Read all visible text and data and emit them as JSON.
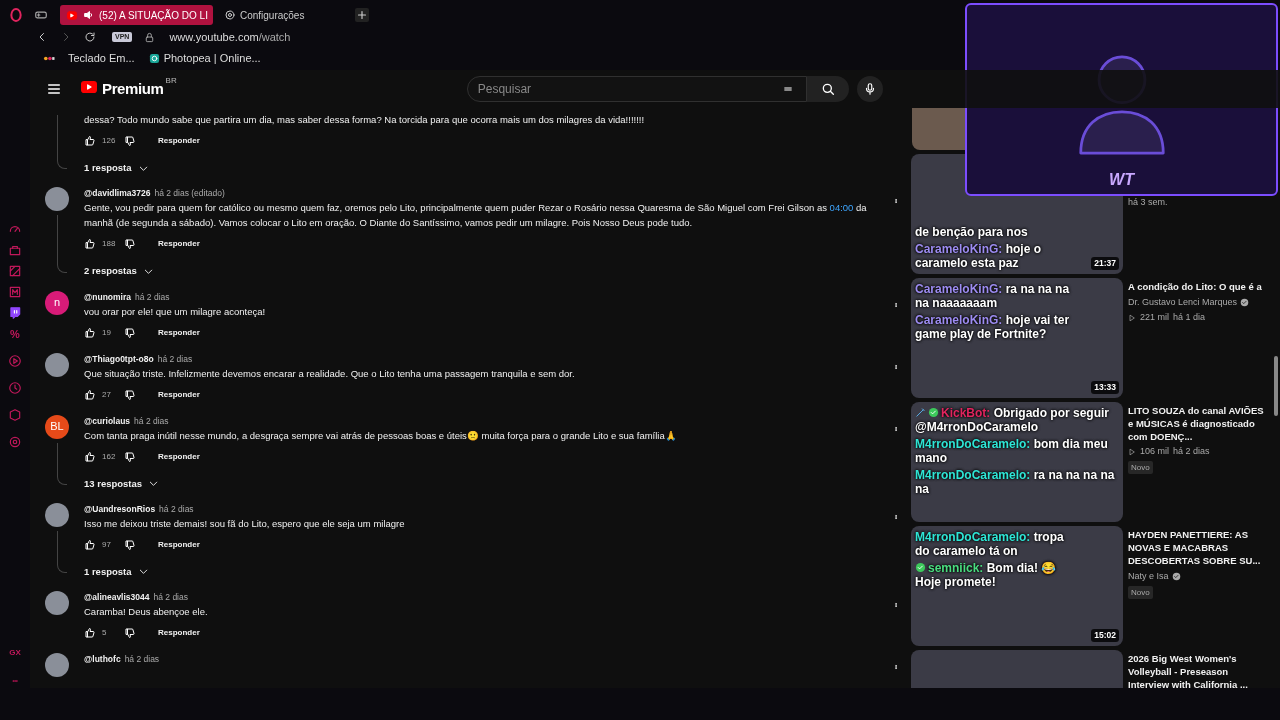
{
  "browser": {
    "tabs": [
      {
        "title": "(52) A SITUAÇÃO DO LI",
        "kind": "youtube",
        "selected": true
      },
      {
        "title": "Configurações",
        "kind": "settings",
        "selected": false
      }
    ],
    "vpn": "VPN",
    "url": {
      "host": "www.youtube.com",
      "path": "/watch"
    },
    "bookmarks": [
      {
        "label": "Teclado Em...",
        "kind": "emoji"
      },
      {
        "label": "Photopea | Online...",
        "kind": "photopea"
      }
    ]
  },
  "sidebar": {
    "percent": "%",
    "brand": "GX"
  },
  "youtube": {
    "logo": "Premium",
    "region": "BR",
    "search": {
      "placeholder": "Pesquisar"
    }
  },
  "comments": [
    {
      "parts": [
        {
          "kind": "plain",
          "text": "dessa? Todo mundo sabe que partira um dia,  mas saber dessa forma? Na torcida para que ocorra mais um dos milagres da vida!!!!!!!"
        }
      ],
      "likes": "126",
      "reply": "Responder",
      "replies": "1 resposta"
    },
    {
      "author": "@davidlima3726",
      "age": "há 2 dias (editado)",
      "avatar": {
        "kind": "photo"
      },
      "parts": [
        {
          "kind": "plain",
          "text": "Gente, vou pedir para quem for católico ou mesmo quem faz, oremos pelo Lito, principalmente quem puder Rezar o Rosário nessa Quaresma de São Miguel com Frei Gilson as "
        },
        {
          "kind": "timestamp",
          "text": "04:00"
        },
        {
          "kind": "plain",
          "text": " da manhã (de segunda a sábado). Vamos colocar o Lito em oração. O Diante do Santíssimo, vamos pedir um milagre. Pois Nosso Deus pode tudo."
        }
      ],
      "likes": "188",
      "reply": "Responder",
      "replies": "2 respostas"
    },
    {
      "author": "@nunomira",
      "age": "há 2 dias",
      "avatar": {
        "kind": "letter",
        "letter": "n",
        "color": "#d81b78"
      },
      "parts": [
        {
          "kind": "plain",
          "text": "vou orar por ele! que um milagre aconteça!"
        }
      ],
      "likes": "19",
      "reply": "Responder"
    },
    {
      "author": "@Thiago0tpt-o8o",
      "age": "há 2 dias",
      "avatar": {
        "kind": "photo"
      },
      "parts": [
        {
          "kind": "plain",
          "text": "Que situação triste. Infelizmente devemos encarar a realidade. Que o Lito tenha uma passagem tranquila e sem dor."
        }
      ],
      "likes": "27",
      "reply": "Responder"
    },
    {
      "author": "@curiolaus",
      "age": "há 2 dias",
      "avatar": {
        "kind": "letter",
        "letter": "BL",
        "color": "#e64a19"
      },
      "parts": [
        {
          "kind": "plain",
          "text": "Com tanta praga inútil nesse mundo, a desgraça sempre vai atrás de pessoas boas e úteis🙁 muita força para o grande Lito e sua família🙏"
        }
      ],
      "likes": "162",
      "reply": "Responder",
      "replies": "13 respostas"
    },
    {
      "author": "@UandresonRios",
      "age": "há 2 dias",
      "avatar": {
        "kind": "photo"
      },
      "parts": [
        {
          "kind": "plain",
          "text": "Isso me deixou triste demais! sou fã do Lito, espero que ele seja um milagre"
        }
      ],
      "likes": "97",
      "reply": "Responder",
      "replies": "1 resposta"
    },
    {
      "author": "@alineavlis3044",
      "age": "há 2 dias",
      "avatar": {
        "kind": "photo"
      },
      "parts": [
        {
          "kind": "plain",
          "text": "Caramba! Deus abençoe ele."
        }
      ],
      "likes": "5",
      "reply": "Responder"
    },
    {
      "author": "@luthofc",
      "age": "há 2 dias",
      "avatar": {
        "kind": "photo"
      }
    }
  ],
  "recommendations": [
    {
      "age": "há 3 sem.",
      "duration": "21:37"
    },
    {
      "title": "A condição do Lito: O que é a",
      "channel": "Dr. Gustavo Lenci Marques",
      "verified": true,
      "views": "221 mil",
      "age": "há 1 dia",
      "duration": "13:33"
    },
    {
      "title": "LITO SOUZA do canal AVIÕES e MÚSICAS é diagnosticado com DOENÇ...",
      "views": "106 mil",
      "age": "há 2 dias",
      "badge": "Novo"
    },
    {
      "title": "HAYDEN PANETTIERE: AS NOVAS E MACABRAS DESCOBERTAS SOBRE SU...",
      "channel": "Naty e Isa",
      "verified": true,
      "badge": "Novo",
      "duration": "15:02"
    },
    {
      "title": "2026 Big West Women's Volleyball - Preseason Interview with California ..."
    }
  ],
  "stream_overlay": {
    "logo": "WT"
  },
  "chat": [
    {
      "text": "de benção para nos"
    },
    {
      "user": "CarameloKinG:",
      "color": "#9d8cf2",
      "text": "hoje o caramelo esta paz"
    },
    {
      "user": "CarameloKinG:",
      "color": "#9d8cf2",
      "text": "ra na na na na naaaaaaam"
    },
    {
      "user": "CarameloKinG:",
      "color": "#9d8cf2",
      "text": "hoje vai ter game play de Fortnite?"
    },
    {
      "user": "KickBot:",
      "color": "#e0245e",
      "badges": [
        {
          "kind": "sword"
        },
        {
          "kind": "verified"
        }
      ],
      "text": "Obrigado por seguir @M4rronDoCaramelo"
    },
    {
      "user": "M4rronDoCaramelo:",
      "color": "#2ee6d6",
      "text": "bom dia meu mano"
    },
    {
      "user": "M4rronDoCaramelo:",
      "color": "#2ee6d6",
      "text": "ra na na na na na"
    },
    {
      "user": "M4rronDoCaramelo:",
      "color": "#2ee6d6",
      "text": "tropa do caramelo tá on"
    },
    {
      "user": "semniick:",
      "color": "#4ade80",
      "badges": [
        {
          "kind": "verified"
        }
      ],
      "text": "Bom dia! 😂 Hoje promete!"
    }
  ]
}
